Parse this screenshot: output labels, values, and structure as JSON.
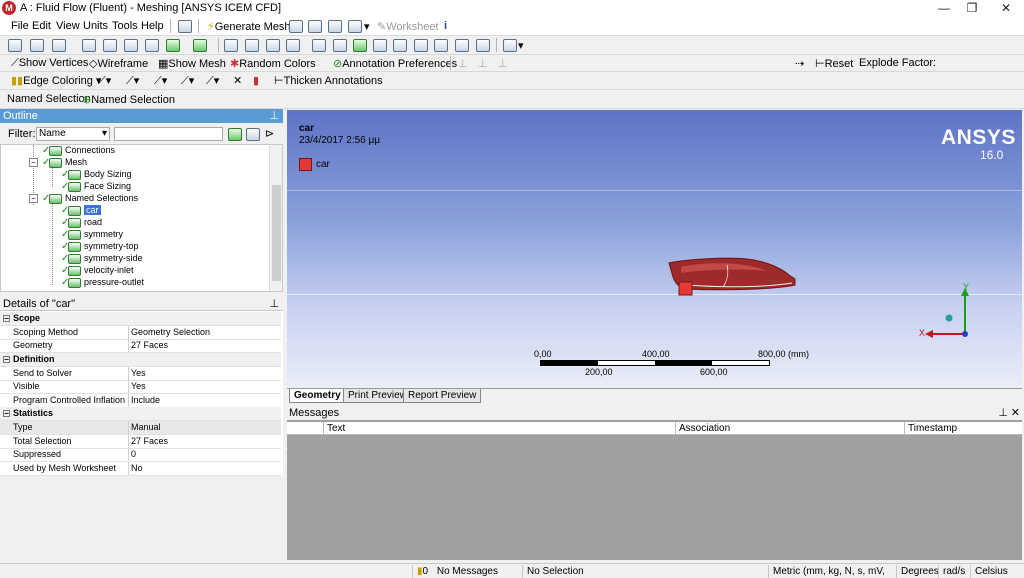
{
  "window": {
    "title": "A : Fluid Flow (Fluent) - Meshing [ANSYS ICEM CFD]",
    "minimize": "—",
    "restore": "❐",
    "close": "✕"
  },
  "menu": [
    "File",
    "Edit",
    "View",
    "Units",
    "Tools",
    "Help"
  ],
  "toolbar1": {
    "generate_mesh": "Generate Mesh",
    "worksheet": "Worksheet"
  },
  "toolbar2": {
    "show_vertices": "Show Vertices",
    "wireframe": "Wireframe",
    "show_mesh": "Show Mesh",
    "random_colors": "Random Colors",
    "annotation_preferences": "Annotation Preferences",
    "reset": "Reset",
    "explode_factor": "Explode Factor:"
  },
  "toolbar3": {
    "edge_coloring": "Edge Coloring",
    "thicken_annotations": "Thicken Annotations"
  },
  "toolbar4": {
    "named_selection_label": "Named Selection",
    "named_selection_button": "Named Selection"
  },
  "outline": {
    "title": "Outline",
    "pin": "⊥",
    "filter_label": "Filter:",
    "filter_value": "Name",
    "search_placeholder": "",
    "tree": [
      {
        "label": "Connections"
      },
      {
        "label": "Mesh"
      },
      {
        "label": "Body Sizing"
      },
      {
        "label": "Face Sizing"
      },
      {
        "label": "Named Selections"
      },
      {
        "label": "car"
      },
      {
        "label": "road"
      },
      {
        "label": "symmetry"
      },
      {
        "label": "symmetry-top"
      },
      {
        "label": "symmetry-side"
      },
      {
        "label": "velocity-inlet"
      },
      {
        "label": "pressure-outlet"
      }
    ]
  },
  "details": {
    "title": "Details of \"car\"",
    "groups": {
      "scope": "Scope",
      "definition": "Definition",
      "statistics": "Statistics"
    },
    "rows": {
      "scoping_method": {
        "k": "Scoping Method",
        "v": "Geometry Selection"
      },
      "geometry": {
        "k": "Geometry",
        "v": "27 Faces"
      },
      "send_to_solver": {
        "k": "Send to Solver",
        "v": "Yes"
      },
      "visible": {
        "k": "Visible",
        "v": "Yes"
      },
      "inflation": {
        "k": "Program Controlled Inflation",
        "v": "Include"
      },
      "type": {
        "k": "Type",
        "v": "Manual"
      },
      "total_selection": {
        "k": "Total Selection",
        "v": "27 Faces"
      },
      "suppressed": {
        "k": "Suppressed",
        "v": "0"
      },
      "used_by_mesh_worksheet": {
        "k": "Used by Mesh Worksheet",
        "v": "No"
      }
    }
  },
  "viewport": {
    "object_name": "car",
    "date": "23/4/2017 2:56 μμ",
    "legend_label": "car",
    "legend_color": "#e53935",
    "brand": "ANSYS",
    "version": "16.0",
    "scale": {
      "top_labels": [
        "0,00",
        "400,00",
        "800,00 (mm)"
      ],
      "bottom_labels": [
        "200,00",
        "600,00"
      ]
    },
    "axis_y": "Y",
    "axis_x": "X"
  },
  "view_tabs": [
    "Geometry",
    "Print Preview",
    "Report Preview"
  ],
  "messages": {
    "title": "Messages",
    "columns": [
      "Text",
      "Association",
      "Timestamp"
    ]
  },
  "status": {
    "messages_count": "0",
    "no_messages": "No Messages",
    "no_selection": "No Selection",
    "units": "Metric (mm, kg, N, s, mV, mA)",
    "degrees": "Degrees",
    "rads": "rad/s",
    "temp": "Celsius"
  },
  "colors": {
    "outline_head": "#5b9bd5",
    "car_body": "#9e2a2a",
    "accent_green": "#2f7d2f"
  }
}
